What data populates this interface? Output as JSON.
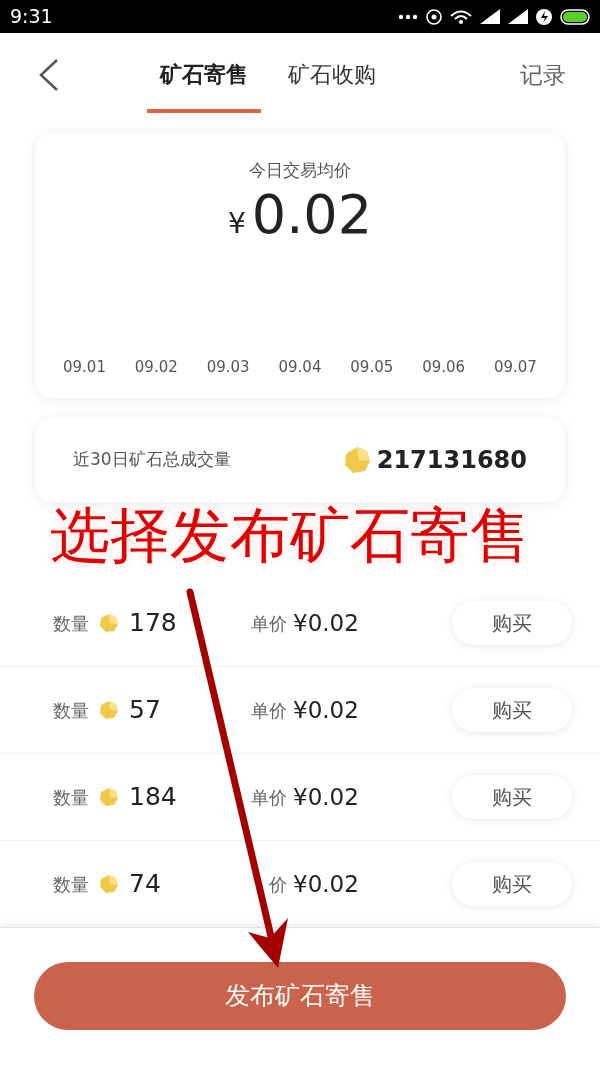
{
  "status_bar": {
    "time": "9:31"
  },
  "tabs": [
    {
      "label": "矿石寄售",
      "selected": true
    },
    {
      "label": "矿石收购",
      "selected": false
    }
  ],
  "record_link": "记录",
  "price_card": {
    "title": "今日交易均价",
    "currency": "¥",
    "price": "0.02",
    "dates": [
      "09.01",
      "09.02",
      "09.03",
      "09.04",
      "09.05",
      "09.06",
      "09.07"
    ]
  },
  "volume_card": {
    "label": "近30日矿石总成交量",
    "value": "217131680"
  },
  "listings": [
    {
      "qty_label": "数量",
      "qty": "178",
      "price_label": "单价",
      "price": "¥0.02",
      "button": "购买"
    },
    {
      "qty_label": "数量",
      "qty": "57",
      "price_label": "单价",
      "price": "¥0.02",
      "button": "购买"
    },
    {
      "qty_label": "数量",
      "qty": "184",
      "price_label": "单价",
      "price": "¥0.02",
      "button": "购买"
    },
    {
      "qty_label": "数量",
      "qty": "74",
      "price_label": "价",
      "price": "¥0.02",
      "button": "购买"
    }
  ],
  "publish_button": "发布矿石寄售",
  "annotation": "选择发布矿石寄售"
}
